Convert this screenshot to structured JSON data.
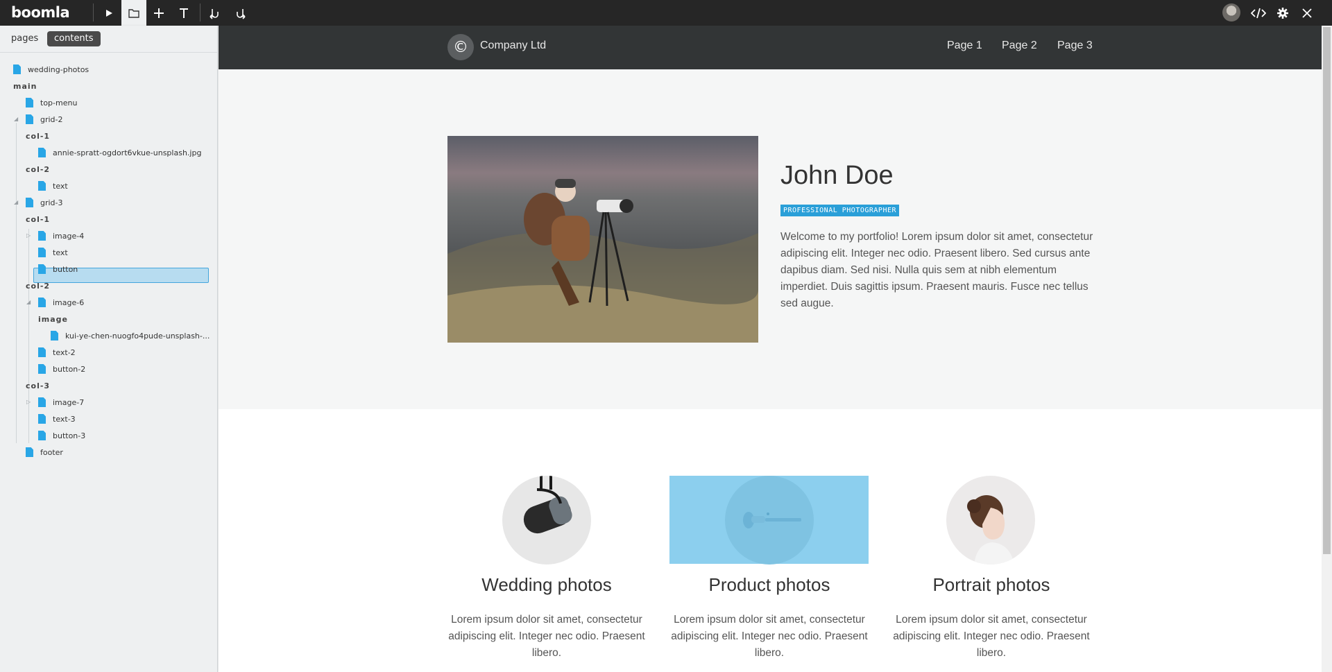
{
  "app": {
    "logo": "boomla",
    "toolbar_icons": [
      "play-icon",
      "folder-icon",
      "plus-icon",
      "text-icon",
      "undo-icon",
      "redo-icon"
    ],
    "right_icons": [
      "avatar",
      "code-icon",
      "gear-icon",
      "close-icon"
    ]
  },
  "sidebar": {
    "tabs": [
      {
        "label": "pages",
        "active": false
      },
      {
        "label": "contents",
        "active": true
      }
    ],
    "tree": [
      {
        "label": "wedding-photos",
        "type": "file"
      },
      {
        "label": "main",
        "type": "group"
      },
      {
        "label": "top-menu",
        "type": "file"
      },
      {
        "label": "grid-2",
        "type": "file",
        "expanded": true
      },
      {
        "label": "col-1",
        "type": "group"
      },
      {
        "label": "annie-spratt-ogdort6vkue-unsplash.jpg",
        "type": "file"
      },
      {
        "label": "col-2",
        "type": "group"
      },
      {
        "label": "text",
        "type": "file"
      },
      {
        "label": "grid-3",
        "type": "file",
        "expanded": true
      },
      {
        "label": "col-1",
        "type": "group"
      },
      {
        "label": "image-4",
        "type": "file",
        "collapsed": true
      },
      {
        "label": "text",
        "type": "file"
      },
      {
        "label": "button",
        "type": "file"
      },
      {
        "label": "col-2",
        "type": "group"
      },
      {
        "label": "image-6",
        "type": "file",
        "expanded": true,
        "selected": true
      },
      {
        "label": "image",
        "type": "group"
      },
      {
        "label": "kui-ye-chen-nuogfo4pude-unsplash-...",
        "type": "file"
      },
      {
        "label": "text-2",
        "type": "file"
      },
      {
        "label": "button-2",
        "type": "file"
      },
      {
        "label": "col-3",
        "type": "group"
      },
      {
        "label": "image-7",
        "type": "file",
        "collapsed": true
      },
      {
        "label": "text-3",
        "type": "file"
      },
      {
        "label": "button-3",
        "type": "file"
      },
      {
        "label": "footer",
        "type": "file"
      }
    ]
  },
  "site": {
    "brand": {
      "icon": "©",
      "name": "Company Ltd"
    },
    "nav": [
      "Page 1",
      "Page 2",
      "Page 3"
    ],
    "hero": {
      "title": "John Doe",
      "badge": "PROFESSIONAL PHOTOGRAPHER",
      "text": "Welcome to my portfolio! Lorem ipsum dolor sit amet, consectetur adipiscing elit. Integer nec odio. Praesent libero. Sed cursus ante dapibus diam. Sed nisi. Nulla quis sem at nibh elementum imperdiet. Duis sagittis ipsum. Praesent mauris. Fusce nec tellus sed augue."
    },
    "services": [
      {
        "title": "Wedding photos",
        "text": "Lorem ipsum dolor sit amet, consectetur adipiscing elit. Integer nec odio. Praesent libero."
      },
      {
        "title": "Product photos",
        "text": "Lorem ipsum dolor sit amet, consectetur adipiscing elit. Integer nec odio. Praesent libero."
      },
      {
        "title": "Portrait photos",
        "text": "Lorem ipsum dolor sit amet, consectetur adipiscing elit. Integer nec odio. Praesent libero."
      }
    ]
  },
  "colors": {
    "toolbar": "#262626",
    "accent": "#2a9fd8",
    "selection": "#b7dcf0",
    "site_header": "#323536"
  }
}
